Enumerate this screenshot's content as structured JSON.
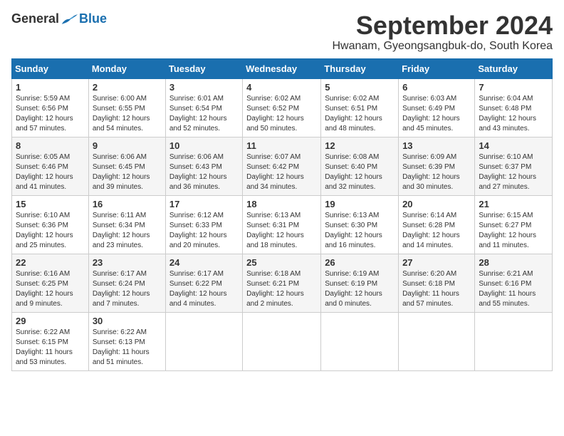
{
  "logo": {
    "general": "General",
    "blue": "Blue"
  },
  "header": {
    "month_title": "September 2024",
    "subtitle": "Hwanam, Gyeongsangbuk-do, South Korea"
  },
  "calendar": {
    "headers": [
      "Sunday",
      "Monday",
      "Tuesday",
      "Wednesday",
      "Thursday",
      "Friday",
      "Saturday"
    ],
    "weeks": [
      [
        {
          "day": "1",
          "info": "Sunrise: 5:59 AM\nSunset: 6:56 PM\nDaylight: 12 hours\nand 57 minutes."
        },
        {
          "day": "2",
          "info": "Sunrise: 6:00 AM\nSunset: 6:55 PM\nDaylight: 12 hours\nand 54 minutes."
        },
        {
          "day": "3",
          "info": "Sunrise: 6:01 AM\nSunset: 6:54 PM\nDaylight: 12 hours\nand 52 minutes."
        },
        {
          "day": "4",
          "info": "Sunrise: 6:02 AM\nSunset: 6:52 PM\nDaylight: 12 hours\nand 50 minutes."
        },
        {
          "day": "5",
          "info": "Sunrise: 6:02 AM\nSunset: 6:51 PM\nDaylight: 12 hours\nand 48 minutes."
        },
        {
          "day": "6",
          "info": "Sunrise: 6:03 AM\nSunset: 6:49 PM\nDaylight: 12 hours\nand 45 minutes."
        },
        {
          "day": "7",
          "info": "Sunrise: 6:04 AM\nSunset: 6:48 PM\nDaylight: 12 hours\nand 43 minutes."
        }
      ],
      [
        {
          "day": "8",
          "info": "Sunrise: 6:05 AM\nSunset: 6:46 PM\nDaylight: 12 hours\nand 41 minutes."
        },
        {
          "day": "9",
          "info": "Sunrise: 6:06 AM\nSunset: 6:45 PM\nDaylight: 12 hours\nand 39 minutes."
        },
        {
          "day": "10",
          "info": "Sunrise: 6:06 AM\nSunset: 6:43 PM\nDaylight: 12 hours\nand 36 minutes."
        },
        {
          "day": "11",
          "info": "Sunrise: 6:07 AM\nSunset: 6:42 PM\nDaylight: 12 hours\nand 34 minutes."
        },
        {
          "day": "12",
          "info": "Sunrise: 6:08 AM\nSunset: 6:40 PM\nDaylight: 12 hours\nand 32 minutes."
        },
        {
          "day": "13",
          "info": "Sunrise: 6:09 AM\nSunset: 6:39 PM\nDaylight: 12 hours\nand 30 minutes."
        },
        {
          "day": "14",
          "info": "Sunrise: 6:10 AM\nSunset: 6:37 PM\nDaylight: 12 hours\nand 27 minutes."
        }
      ],
      [
        {
          "day": "15",
          "info": "Sunrise: 6:10 AM\nSunset: 6:36 PM\nDaylight: 12 hours\nand 25 minutes."
        },
        {
          "day": "16",
          "info": "Sunrise: 6:11 AM\nSunset: 6:34 PM\nDaylight: 12 hours\nand 23 minutes."
        },
        {
          "day": "17",
          "info": "Sunrise: 6:12 AM\nSunset: 6:33 PM\nDaylight: 12 hours\nand 20 minutes."
        },
        {
          "day": "18",
          "info": "Sunrise: 6:13 AM\nSunset: 6:31 PM\nDaylight: 12 hours\nand 18 minutes."
        },
        {
          "day": "19",
          "info": "Sunrise: 6:13 AM\nSunset: 6:30 PM\nDaylight: 12 hours\nand 16 minutes."
        },
        {
          "day": "20",
          "info": "Sunrise: 6:14 AM\nSunset: 6:28 PM\nDaylight: 12 hours\nand 14 minutes."
        },
        {
          "day": "21",
          "info": "Sunrise: 6:15 AM\nSunset: 6:27 PM\nDaylight: 12 hours\nand 11 minutes."
        }
      ],
      [
        {
          "day": "22",
          "info": "Sunrise: 6:16 AM\nSunset: 6:25 PM\nDaylight: 12 hours\nand 9 minutes."
        },
        {
          "day": "23",
          "info": "Sunrise: 6:17 AM\nSunset: 6:24 PM\nDaylight: 12 hours\nand 7 minutes."
        },
        {
          "day": "24",
          "info": "Sunrise: 6:17 AM\nSunset: 6:22 PM\nDaylight: 12 hours\nand 4 minutes."
        },
        {
          "day": "25",
          "info": "Sunrise: 6:18 AM\nSunset: 6:21 PM\nDaylight: 12 hours\nand 2 minutes."
        },
        {
          "day": "26",
          "info": "Sunrise: 6:19 AM\nSunset: 6:19 PM\nDaylight: 12 hours\nand 0 minutes."
        },
        {
          "day": "27",
          "info": "Sunrise: 6:20 AM\nSunset: 6:18 PM\nDaylight: 11 hours\nand 57 minutes."
        },
        {
          "day": "28",
          "info": "Sunrise: 6:21 AM\nSunset: 6:16 PM\nDaylight: 11 hours\nand 55 minutes."
        }
      ],
      [
        {
          "day": "29",
          "info": "Sunrise: 6:22 AM\nSunset: 6:15 PM\nDaylight: 11 hours\nand 53 minutes."
        },
        {
          "day": "30",
          "info": "Sunrise: 6:22 AM\nSunset: 6:13 PM\nDaylight: 11 hours\nand 51 minutes."
        },
        null,
        null,
        null,
        null,
        null
      ]
    ]
  }
}
